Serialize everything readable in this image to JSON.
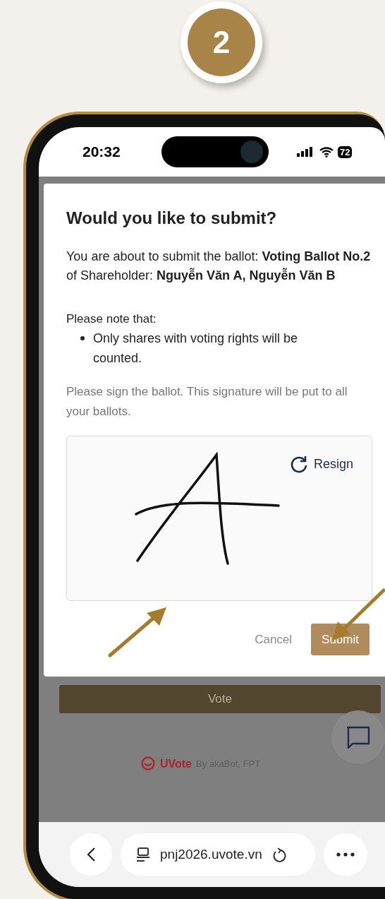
{
  "step_badge": "2",
  "status_bar": {
    "time": "20:32",
    "battery": "72"
  },
  "dialog": {
    "title": "Would you like to submit?",
    "message": "You are about to submit the ballot: **Voting Ballot No.2** of Shareholder: **Nguyễn Văn A, Nguyễn Văn B**",
    "note_heading": "Please note that:",
    "notes": [
      "Only shares with voting rights will be counted."
    ],
    "sign_hint": "Please sign the ballot. This signature will be put to all your ballots.",
    "signature_pad": {
      "resign_label": "Resign"
    },
    "buttons": [
      {
        "label": "Cancel",
        "kind": "secondary"
      },
      {
        "label": "Submit",
        "kind": "primary"
      }
    ]
  },
  "page": {
    "vote_button": "Vote",
    "footer_brand": "UVote",
    "footer_text": "By akaBot, FPT"
  },
  "browser": {
    "url": "pnj2026.uvote.vn"
  }
}
